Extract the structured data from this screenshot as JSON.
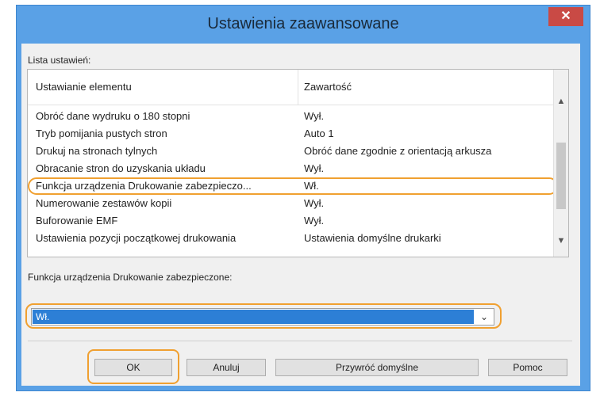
{
  "window": {
    "title": "Ustawienia zaawansowane",
    "close_symbol": "✕"
  },
  "settings_list": {
    "label": "Lista ustawień:",
    "columns": [
      "Ustawianie elementu",
      "Zawartość"
    ],
    "rows": [
      {
        "item": "Obróć dane wydruku o 180 stopni",
        "value": "Wył."
      },
      {
        "item": "Tryb pomijania pustych stron",
        "value": "Auto 1"
      },
      {
        "item": "Drukuj na stronach tylnych",
        "value": "Obróć dane zgodnie z orientacją arkusza"
      },
      {
        "item": "Obracanie stron do uzyskania układu",
        "value": "Wył."
      },
      {
        "item": "Funkcja urządzenia Drukowanie zabezpieczo...",
        "value": "Wł."
      },
      {
        "item": "Numerowanie zestawów kopii",
        "value": "Wył."
      },
      {
        "item": "Buforowanie EMF",
        "value": "Wył."
      },
      {
        "item": "Ustawienia pozycji początkowej drukowania",
        "value": "Ustawienia domyślne drukarki"
      }
    ],
    "highlighted_row_index": 4
  },
  "secure_print": {
    "label": "Funkcja urządzenia Drukowanie zabezpieczone:",
    "selected_value": "Wł."
  },
  "buttons": {
    "ok": "OK",
    "cancel": "Anuluj",
    "restore_defaults": "Przywróć domyślne",
    "help": "Pomoc"
  },
  "colors": {
    "titlebar": "#5aa1e6",
    "highlight_outline": "#f0a030",
    "selection": "#2d7fd6",
    "close_button": "#c94a45"
  },
  "icons": {
    "scroll_up": "chevron-up-icon",
    "scroll_down": "chevron-down-icon",
    "dropdown": "chevron-down-icon",
    "close": "close-icon"
  }
}
